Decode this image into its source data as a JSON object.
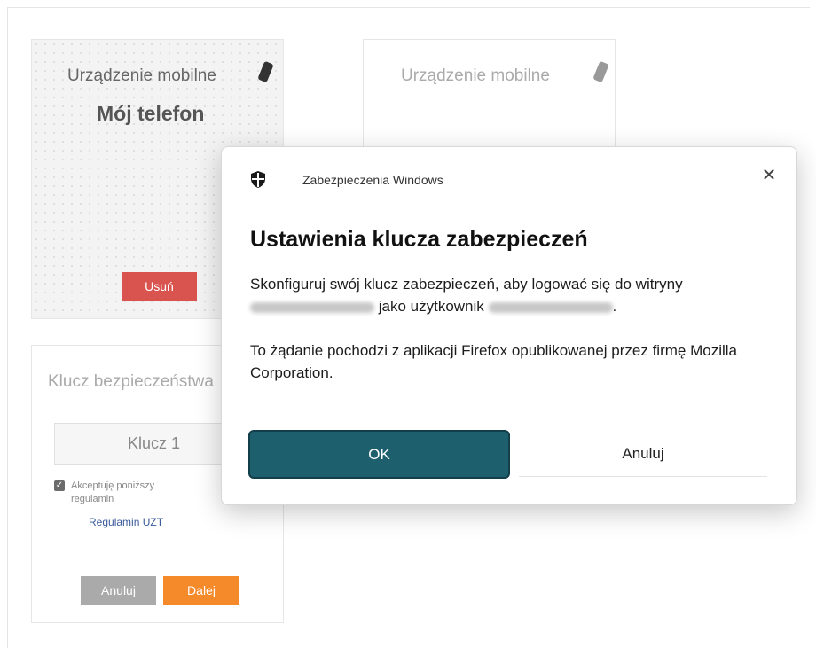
{
  "card_mobile": {
    "title": "Urządzenie mobilne",
    "device_name": "Mój telefon",
    "remove_button": "Usuń"
  },
  "card_mobile_second": {
    "title": "Urządzenie mobilne"
  },
  "card_key": {
    "title": "Klucz bezpieczeństwa",
    "key_name": "Klucz 1",
    "accept_text": "Akceptuję poniższy regulamin",
    "terms_link": "Regulamin UZT",
    "cancel_button": "Anuluj",
    "next_button": "Dalej"
  },
  "dialog": {
    "app_name": "Zabezpieczenia Windows",
    "close_glyph": "✕",
    "heading": "Ustawienia klucza zabezpieczeń",
    "body_line1": "Skonfiguruj swój klucz zabezpieczeń, aby logować się do witryny",
    "body_line2_mid": "jako użytkownik",
    "body_line2_end": ".",
    "body_para2": "To żądanie pochodzi z aplikacji Firefox opublikowanej przez firmę Mozilla Corporation.",
    "ok_button": "OK",
    "cancel_button": "Anuluj"
  },
  "icons": {
    "shield": "shield-icon",
    "phone": "mobile-phone-icon",
    "close": "close-icon",
    "checkbox": "checkbox-checked-icon"
  },
  "colors": {
    "ok_button": "#1e5f6d",
    "remove_button": "#d9534f",
    "next_button": "#f58a2a",
    "cancel_small_button": "#aaaaaa"
  }
}
